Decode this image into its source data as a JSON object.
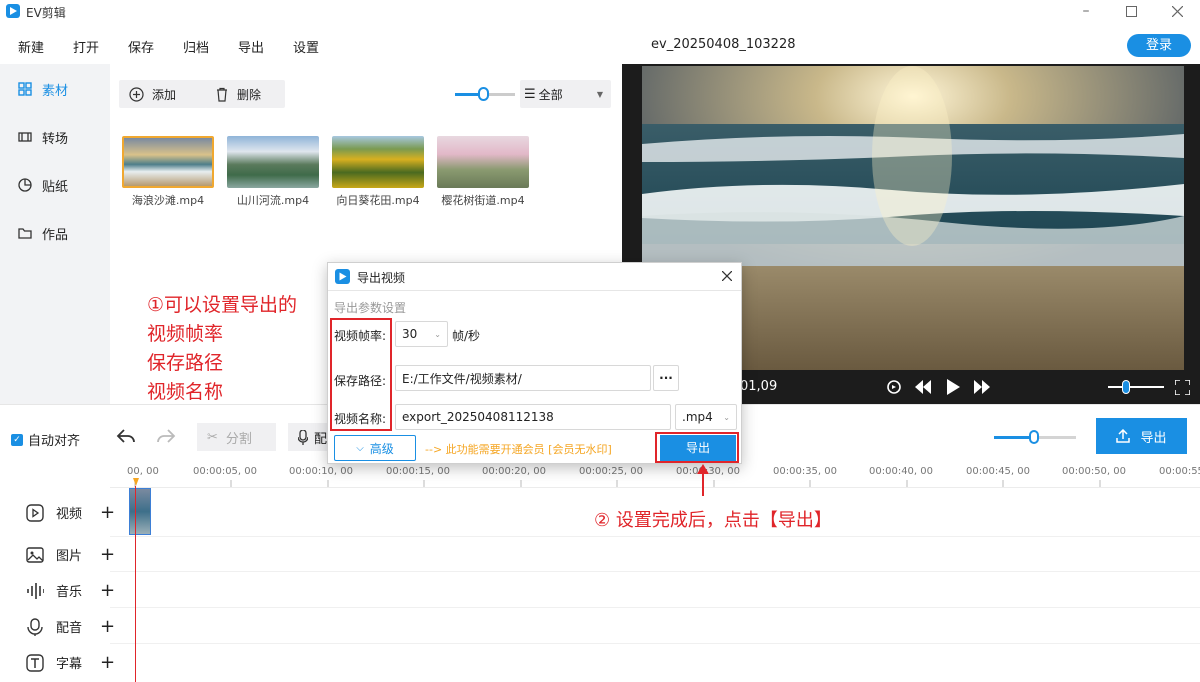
{
  "app": {
    "title": "EV剪辑",
    "project_name": "ev_20250408_103228",
    "login_label": "登录"
  },
  "menu": [
    "新建",
    "打开",
    "保存",
    "归档",
    "导出",
    "设置"
  ],
  "sidebar": {
    "items": [
      {
        "label": "素材",
        "icon": "grid-icon",
        "active": true
      },
      {
        "label": "转场",
        "icon": "film-icon",
        "active": false
      },
      {
        "label": "贴纸",
        "icon": "pie-icon",
        "active": false
      },
      {
        "label": "作品",
        "icon": "folder-icon",
        "active": false
      }
    ]
  },
  "media_toolbar": {
    "add_label": "添加",
    "delete_label": "删除",
    "filter_label": "全部",
    "zoom_value": "0"
  },
  "media_files": [
    {
      "name": "海浪沙滩.mp4",
      "selected": true
    },
    {
      "name": "山川河流.mp4",
      "selected": false
    },
    {
      "name": "向日葵花田.mp4",
      "selected": false
    },
    {
      "name": "樱花树街道.mp4",
      "selected": false
    }
  ],
  "player": {
    "time_fragment": "01,09",
    "progress": 0.0
  },
  "timeline_toolbar": {
    "auto_align_label": "自动对齐",
    "auto_align_checked": true,
    "split_label": "分割",
    "voice_label_partial": "配",
    "zoom_value": "0",
    "export_label": "导出"
  },
  "ruler_ticks": [
    "00, 00",
    "00:00:05, 00",
    "00:00:10, 00",
    "00:00:15, 00",
    "00:00:20, 00",
    "00:00:25, 00",
    "00:00:30, 00",
    "00:00:35, 00",
    "00:00:40, 00",
    "00:00:45, 00",
    "00:00:50, 00",
    "00:00:55"
  ],
  "tracks": [
    {
      "label": "视频",
      "icon": "video-icon"
    },
    {
      "label": "图片",
      "icon": "image-icon"
    },
    {
      "label": "音乐",
      "icon": "audio-wave-icon"
    },
    {
      "label": "配音",
      "icon": "mic-icon"
    },
    {
      "label": "字幕",
      "icon": "text-icon"
    }
  ],
  "dialog": {
    "title": "导出视频",
    "section_label": "导出参数设置",
    "framerate_label": "视频帧率:",
    "framerate_value": "30",
    "framerate_unit": "帧/秒",
    "path_label": "保存路径:",
    "path_value": "E:/工作文件/视频素材/",
    "path_browse": "···",
    "name_label": "视频名称:",
    "name_value": "export_20250408112138",
    "format_value": ".mp4",
    "advanced_label": "高级",
    "vip_notice": "--> 此功能需要开通会员 [会员无水印]",
    "export_label": "导出"
  },
  "annotations": {
    "left_lines": [
      "①可以设置导出的",
      "视频帧率",
      "保存路径",
      "视频名称"
    ],
    "bottom": "② 设置完成后，点击【导出】"
  },
  "colors": {
    "accent": "#1a8fe3",
    "annotation_red": "#e0252a",
    "vip_orange": "#f5a623"
  }
}
